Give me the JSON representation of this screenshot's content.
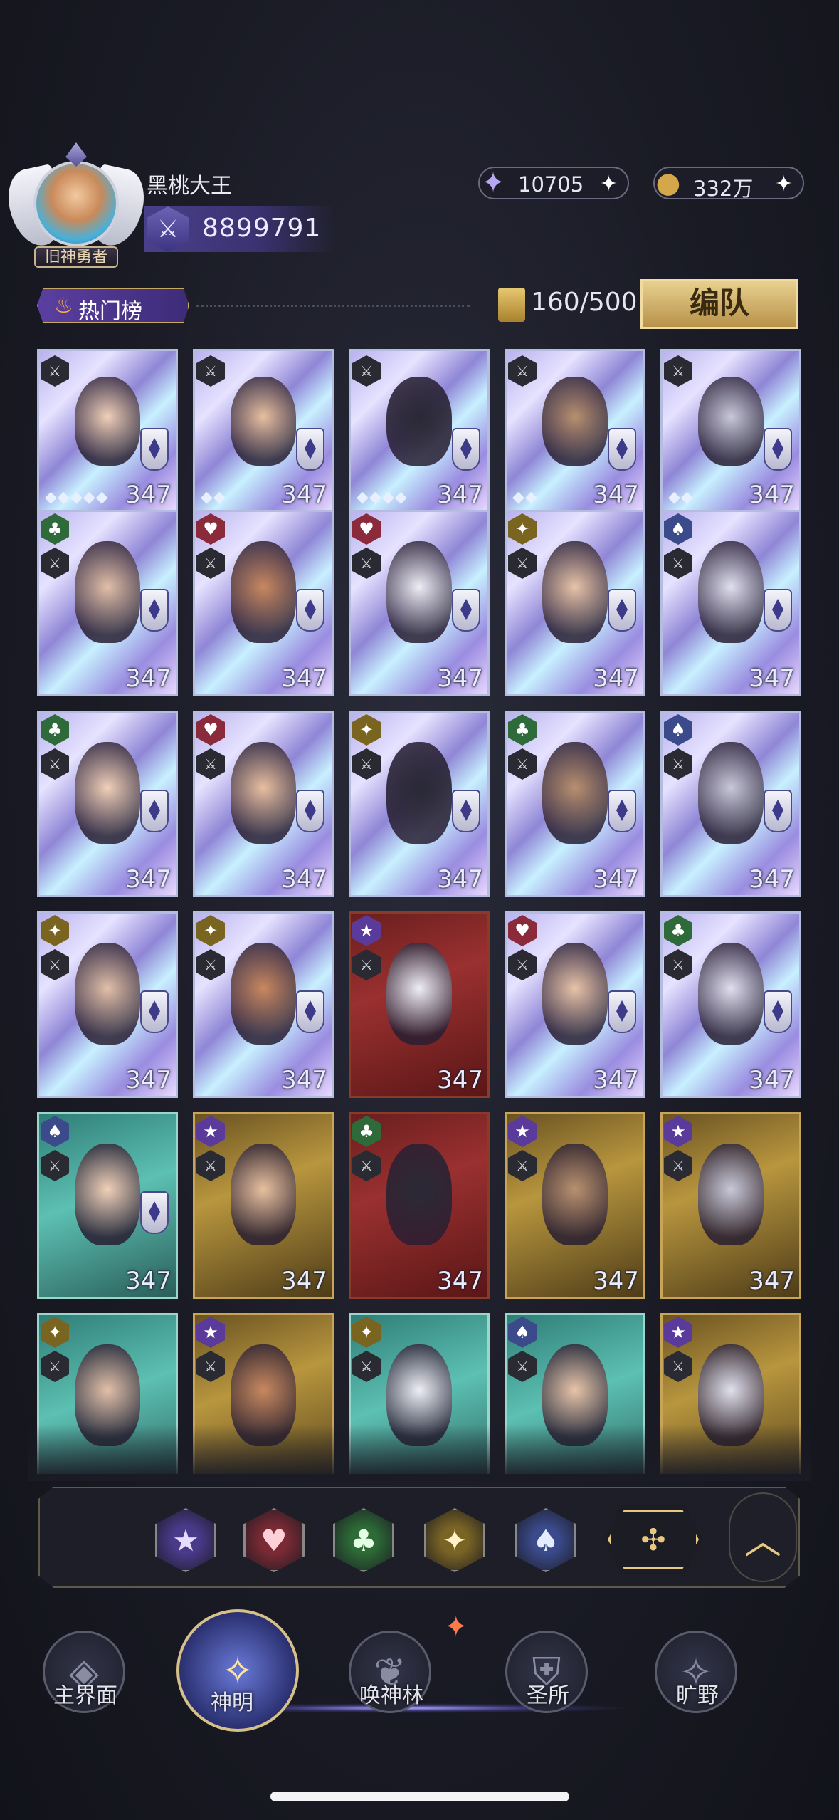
{
  "player": {
    "name": "黑桃大王",
    "title_plate": "旧神勇者",
    "power": "8899791"
  },
  "resources": [
    {
      "name": "crystal",
      "value": "10705",
      "icon": "star-crystal-icon"
    },
    {
      "name": "coin",
      "value": "332万",
      "icon": "gold-coin-icon"
    }
  ],
  "toolbar": {
    "hot_label": "热门榜",
    "capacity": "160/500",
    "team_button": "编队"
  },
  "colors": {
    "holo": "#9a8ce0",
    "red": "#8a2a2a",
    "gold": "#b8963e",
    "teal": "#3aa59a"
  },
  "cards": [
    {
      "level": "347",
      "suit": "spade-icon",
      "suit_color": "#3a3a48",
      "frame": "holo",
      "stars": "◆◆◆◆◆"
    },
    {
      "level": "347",
      "suit": "spade-icon",
      "suit_color": "#3a3a48",
      "frame": "holo",
      "stars": "◆◆"
    },
    {
      "level": "347",
      "suit": "spade-icon",
      "suit_color": "#3a3a48",
      "frame": "holo",
      "stars": "◆◆◆◆"
    },
    {
      "level": "347",
      "suit": "spade-icon",
      "suit_color": "#3a3a48",
      "frame": "holo",
      "stars": "◆◆"
    },
    {
      "level": "347",
      "suit": "spade-icon",
      "suit_color": "#3a3a48",
      "frame": "holo",
      "stars": "◆◆"
    },
    {
      "level": "347",
      "suit": "club-icon",
      "suit_color": "#2f6a3a",
      "frame": "holo",
      "stars": ""
    },
    {
      "level": "347",
      "suit": "heart-icon",
      "suit_color": "#8a2a3a",
      "frame": "holo",
      "stars": ""
    },
    {
      "level": "347",
      "suit": "heart-icon",
      "suit_color": "#8a2a3a",
      "frame": "holo",
      "stars": ""
    },
    {
      "level": "347",
      "suit": "diamond-icon",
      "suit_color": "#7a6520",
      "frame": "holo",
      "stars": ""
    },
    {
      "level": "347",
      "suit": "spade-icon",
      "suit_color": "#3a4a8a",
      "frame": "holo",
      "stars": ""
    },
    {
      "level": "347",
      "suit": "club-icon",
      "suit_color": "#2f6a3a",
      "frame": "holo",
      "stars": ""
    },
    {
      "level": "347",
      "suit": "heart-icon",
      "suit_color": "#8a2a3a",
      "frame": "holo",
      "stars": ""
    },
    {
      "level": "347",
      "suit": "diamond-icon",
      "suit_color": "#7a6520",
      "frame": "holo",
      "stars": ""
    },
    {
      "level": "347",
      "suit": "club-icon",
      "suit_color": "#2f6a3a",
      "frame": "holo",
      "stars": ""
    },
    {
      "level": "347",
      "suit": "spade-icon",
      "suit_color": "#3a4a8a",
      "frame": "holo",
      "stars": ""
    },
    {
      "level": "347",
      "suit": "diamond-icon",
      "suit_color": "#7a6520",
      "frame": "holo",
      "stars": ""
    },
    {
      "level": "347",
      "suit": "diamond-icon",
      "suit_color": "#7a6520",
      "frame": "holo",
      "stars": ""
    },
    {
      "level": "347",
      "suit": "star-icon",
      "suit_color": "#5a3a9a",
      "frame": "red",
      "stars": ""
    },
    {
      "level": "347",
      "suit": "heart-icon",
      "suit_color": "#8a2a3a",
      "frame": "holo",
      "stars": ""
    },
    {
      "level": "347",
      "suit": "club-icon",
      "suit_color": "#2f6a3a",
      "frame": "holo",
      "stars": ""
    },
    {
      "level": "347",
      "suit": "spade-icon",
      "suit_color": "#3a4a8a",
      "frame": "teal",
      "stars": ""
    },
    {
      "level": "347",
      "suit": "star-icon",
      "suit_color": "#5a3a9a",
      "frame": "gold",
      "stars": ""
    },
    {
      "level": "347",
      "suit": "club-icon",
      "suit_color": "#2f6a3a",
      "frame": "red",
      "stars": ""
    },
    {
      "level": "347",
      "suit": "star-icon",
      "suit_color": "#5a3a9a",
      "frame": "gold",
      "stars": ""
    },
    {
      "level": "347",
      "suit": "star-icon",
      "suit_color": "#5a3a9a",
      "frame": "gold",
      "stars": ""
    },
    {
      "level": "",
      "suit": "diamond-icon",
      "suit_color": "#7a6520",
      "frame": "teal",
      "stars": ""
    },
    {
      "level": "",
      "suit": "star-icon",
      "suit_color": "#5a3a9a",
      "frame": "gold",
      "stars": ""
    },
    {
      "level": "",
      "suit": "diamond-icon",
      "suit_color": "#7a6520",
      "frame": "teal",
      "stars": ""
    },
    {
      "level": "",
      "suit": "spade-icon",
      "suit_color": "#3a4a8a",
      "frame": "teal",
      "stars": ""
    },
    {
      "level": "",
      "suit": "star-icon",
      "suit_color": "#5a3a9a",
      "frame": "gold",
      "stars": ""
    }
  ],
  "filters": [
    {
      "name": "star-filter",
      "icon": "star-icon",
      "glyph": "★",
      "bg": "#4a3a8a",
      "fg": "#e6dcff"
    },
    {
      "name": "heart-filter",
      "icon": "heart-icon",
      "glyph": "♥",
      "bg": "#7a2a34",
      "fg": "#ffd0d8"
    },
    {
      "name": "club-filter",
      "icon": "club-icon",
      "glyph": "♣",
      "bg": "#2d6a36",
      "fg": "#e4ffe4"
    },
    {
      "name": "diamond-filter",
      "icon": "diamond-icon",
      "glyph": "✦",
      "bg": "#7a6424",
      "fg": "#fff2c8"
    },
    {
      "name": "spade-filter",
      "icon": "spade-icon",
      "glyph": "♠",
      "bg": "#3a4a8a",
      "fg": "#e4ecff"
    },
    {
      "name": "all-filter",
      "icon": "all-suits-icon",
      "glyph": "✣",
      "bg": "#1c1c24",
      "fg": "#e6c880",
      "selected": true
    }
  ],
  "nav": [
    {
      "label": "主界面",
      "icon": "home-emblem-icon",
      "glyph": "◈"
    },
    {
      "label": "神明",
      "icon": "gods-card-icon",
      "glyph": "✧",
      "active": true
    },
    {
      "label": "唤神林",
      "icon": "summon-tree-icon",
      "glyph": "❦"
    },
    {
      "label": "圣所",
      "icon": "sanctuary-icon",
      "glyph": "⛨"
    },
    {
      "label": "旷野",
      "icon": "compass-icon",
      "glyph": "✧"
    }
  ]
}
